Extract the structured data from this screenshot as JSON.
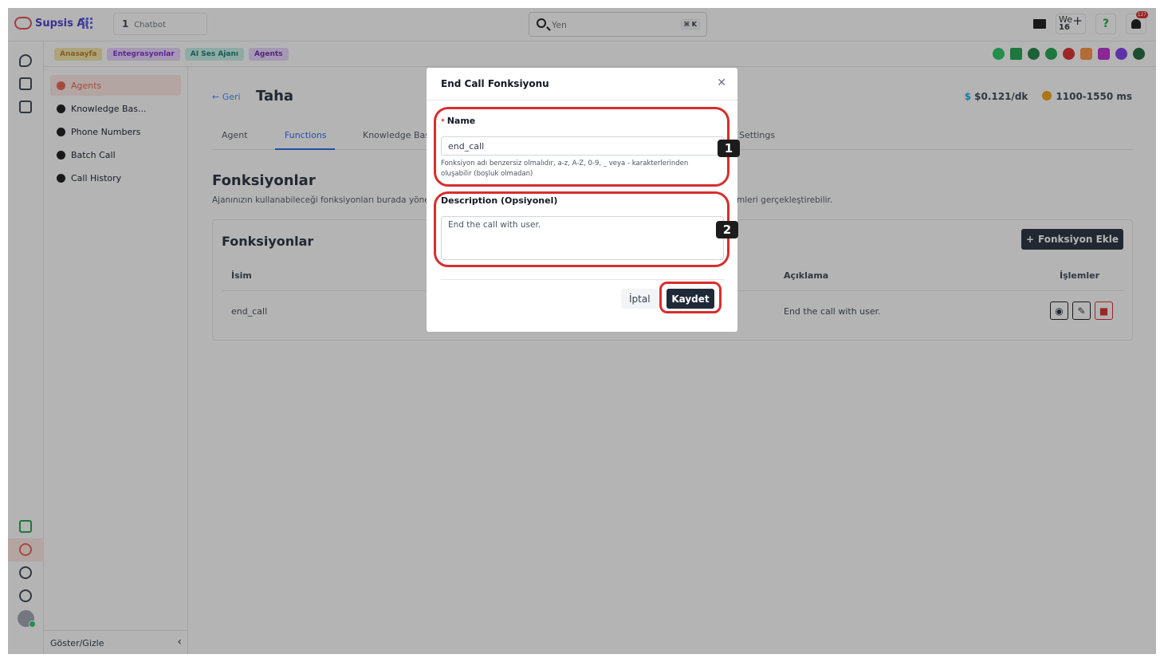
{
  "topbar": {
    "brand": "Supsis Ai",
    "chatbot_count": "1",
    "chatbot_label": "Chatbot",
    "search_placeholder": "Yen",
    "search_shortcut": "⌘ K",
    "user_initials": "We",
    "user_number": "16",
    "notification_count": "127"
  },
  "breadcrumbs": [
    {
      "label": "Anasayfa",
      "color": "#f6e7a6",
      "text_color": "#b7791f"
    },
    {
      "label": "Entegrasyonlar",
      "color": "#e9d5ff",
      "text_color": "#7e22ce"
    },
    {
      "label": "AI Ses Ajanı",
      "color": "#c7f0e9",
      "text_color": "#0f766e"
    },
    {
      "label": "Agents",
      "color": "#e9d5ff",
      "text_color": "#6b21a8"
    }
  ],
  "sidebar": {
    "items": [
      {
        "label": "Agents",
        "icon": "agent-icon"
      },
      {
        "label": "Knowledge Bas...",
        "icon": "bulb-icon"
      },
      {
        "label": "Phone Numbers",
        "icon": "phone-icon"
      },
      {
        "label": "Batch Call",
        "icon": "phone-icon"
      },
      {
        "label": "Call History",
        "icon": "history-icon"
      }
    ],
    "footer_label": "Göster/Gizle"
  },
  "main": {
    "back_label": "Geri",
    "title": "Taha",
    "price": "$0.121/dk",
    "latency": "1100-1550 ms",
    "tabs": [
      "Agent",
      "Functions",
      "Knowledge Bas",
      "Settings"
    ],
    "section_title": "Fonksiyonlar",
    "section_desc_left": "Ajanınızın kullanabileceği fonksiyonları burada yöne",
    "section_desc_right": "mleri gerçekleştirebilir.",
    "card_title": "Fonksiyonlar",
    "add_button": "Fonksiyon Ekle",
    "columns": [
      "İsim",
      "Açıklama",
      "İşlemler"
    ],
    "rows": [
      {
        "name": "end_call",
        "description": "End the call with user."
      }
    ]
  },
  "modal": {
    "title": "End Call Fonksiyonu",
    "name_label": "Name",
    "name_value": "end_call",
    "name_hint": "Fonksiyon adı benzersiz olmalıdır, a-z, A-Z, 0-9, _ veya - karakterlerinden oluşabilir (boşluk olmadan)",
    "description_label": "Description (Opsiyonel)",
    "description_value": "End the call with user.",
    "cancel_label": "İptal",
    "save_label": "Kaydet"
  },
  "annotations": {
    "marker_1": "1",
    "marker_2": "2",
    "color": "#d92d2d"
  }
}
